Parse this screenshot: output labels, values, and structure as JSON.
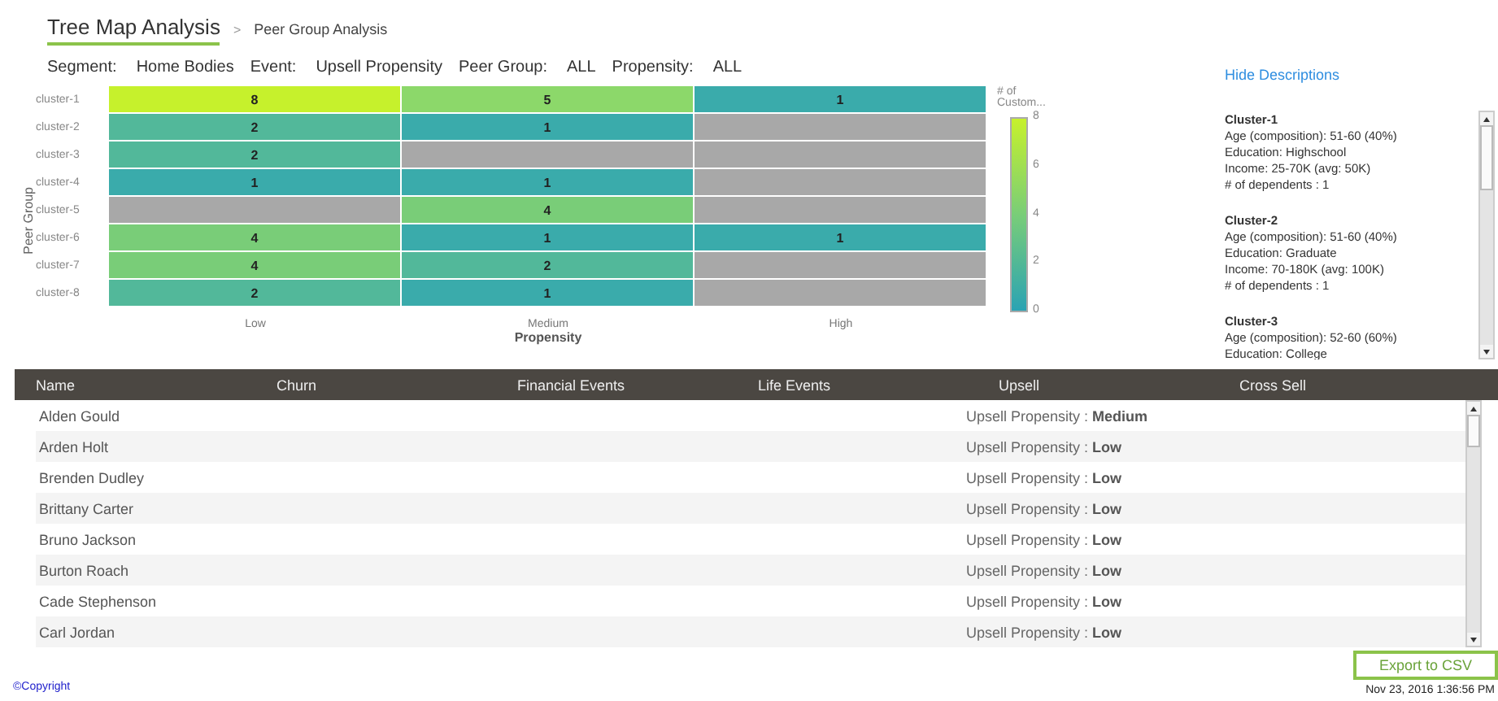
{
  "header": {
    "title": "Tree Map Analysis",
    "breadcrumb_separator": ">",
    "breadcrumb": "Peer Group Analysis"
  },
  "filters": [
    {
      "label": "Segment:",
      "value": "Home Bodies"
    },
    {
      "label": "Event:",
      "value": "Upsell Propensity"
    },
    {
      "label": "Peer Group:",
      "value": "ALL"
    },
    {
      "label": "Propensity:",
      "value": "ALL"
    }
  ],
  "heatmap": {
    "ylabel": "Peer Group",
    "xlabel": "Propensity",
    "x_labels": [
      "Low",
      "Medium",
      "High"
    ],
    "rows": [
      {
        "label": "cluster-1",
        "cells": [
          {
            "value": "8",
            "color": "#c6f12c"
          },
          {
            "value": "5",
            "color": "#8cd86a"
          },
          {
            "value": "1",
            "color": "#3aabab"
          }
        ]
      },
      {
        "label": "cluster-2",
        "cells": [
          {
            "value": "2",
            "color": "#52b89a"
          },
          {
            "value": "1",
            "color": "#3aabab"
          },
          {
            "color": "#a8a8a8"
          }
        ]
      },
      {
        "label": "cluster-3",
        "cells": [
          {
            "value": "2",
            "color": "#52b89a"
          },
          {
            "color": "#a8a8a8"
          },
          {
            "color": "#a8a8a8"
          }
        ]
      },
      {
        "label": "cluster-4",
        "cells": [
          {
            "value": "1",
            "color": "#3aabab"
          },
          {
            "value": "1",
            "color": "#3aabab"
          },
          {
            "color": "#a8a8a8"
          }
        ]
      },
      {
        "label": "cluster-5",
        "cells": [
          {
            "color": "#a8a8a8"
          },
          {
            "value": "4",
            "color": "#79cd78"
          },
          {
            "color": "#a8a8a8"
          }
        ]
      },
      {
        "label": "cluster-6",
        "cells": [
          {
            "value": "4",
            "color": "#79cd78"
          },
          {
            "value": "1",
            "color": "#3aabab"
          },
          {
            "value": "1",
            "color": "#3aabab"
          }
        ]
      },
      {
        "label": "cluster-7",
        "cells": [
          {
            "value": "4",
            "color": "#79cd78"
          },
          {
            "value": "2",
            "color": "#52b89a"
          },
          {
            "color": "#a8a8a8"
          }
        ]
      },
      {
        "label": "cluster-8",
        "cells": [
          {
            "value": "2",
            "color": "#52b89a"
          },
          {
            "value": "1",
            "color": "#3aabab"
          },
          {
            "color": "#a8a8a8"
          }
        ]
      }
    ],
    "legend": {
      "title": "# of Custom...",
      "ticks": [
        "8",
        "6",
        "4",
        "2",
        "0"
      ]
    }
  },
  "descriptions": {
    "toggle": "Hide Descriptions",
    "clusters": [
      {
        "title": "Cluster-1",
        "lines": [
          "Age (composition): 51-60 (40%)",
          "Education: Highschool",
          "Income: 25-70K (avg: 50K)",
          "# of dependents : 1"
        ]
      },
      {
        "title": "Cluster-2",
        "lines": [
          "Age (composition): 51-60 (40%)",
          "Education: Graduate",
          "Income: 70-180K (avg: 100K)",
          "# of dependents : 1"
        ]
      },
      {
        "title": "Cluster-3",
        "lines": [
          "Age (composition): 52-60 (60%)",
          "Education: College"
        ]
      }
    ]
  },
  "table": {
    "columns": [
      "Name",
      "Churn",
      "Financial Events",
      "Life Events",
      "Upsell",
      "Cross Sell"
    ],
    "rows": [
      {
        "name": "Alden Gould",
        "upsell": "Upsell Propensity : **Medium**"
      },
      {
        "name": "Arden Holt",
        "upsell": "Upsell Propensity : **Low**"
      },
      {
        "name": "Brenden Dudley",
        "upsell": "Upsell Propensity : **Low**"
      },
      {
        "name": "Brittany Carter",
        "upsell": "Upsell Propensity : **Low**"
      },
      {
        "name": "Bruno Jackson",
        "upsell": "Upsell Propensity : **Low**"
      },
      {
        "name": "Burton Roach",
        "upsell": "Upsell Propensity : **Low**"
      },
      {
        "name": "Cade Stephenson",
        "upsell": "Upsell Propensity : **Low**"
      },
      {
        "name": "Carl Jordan",
        "upsell": "Upsell Propensity : **Low**"
      }
    ]
  },
  "export_button": "Export to CSV",
  "footer": {
    "copyright": "©Copyright",
    "timestamp": "Nov 23, 2016   1:36:56 PM"
  }
}
